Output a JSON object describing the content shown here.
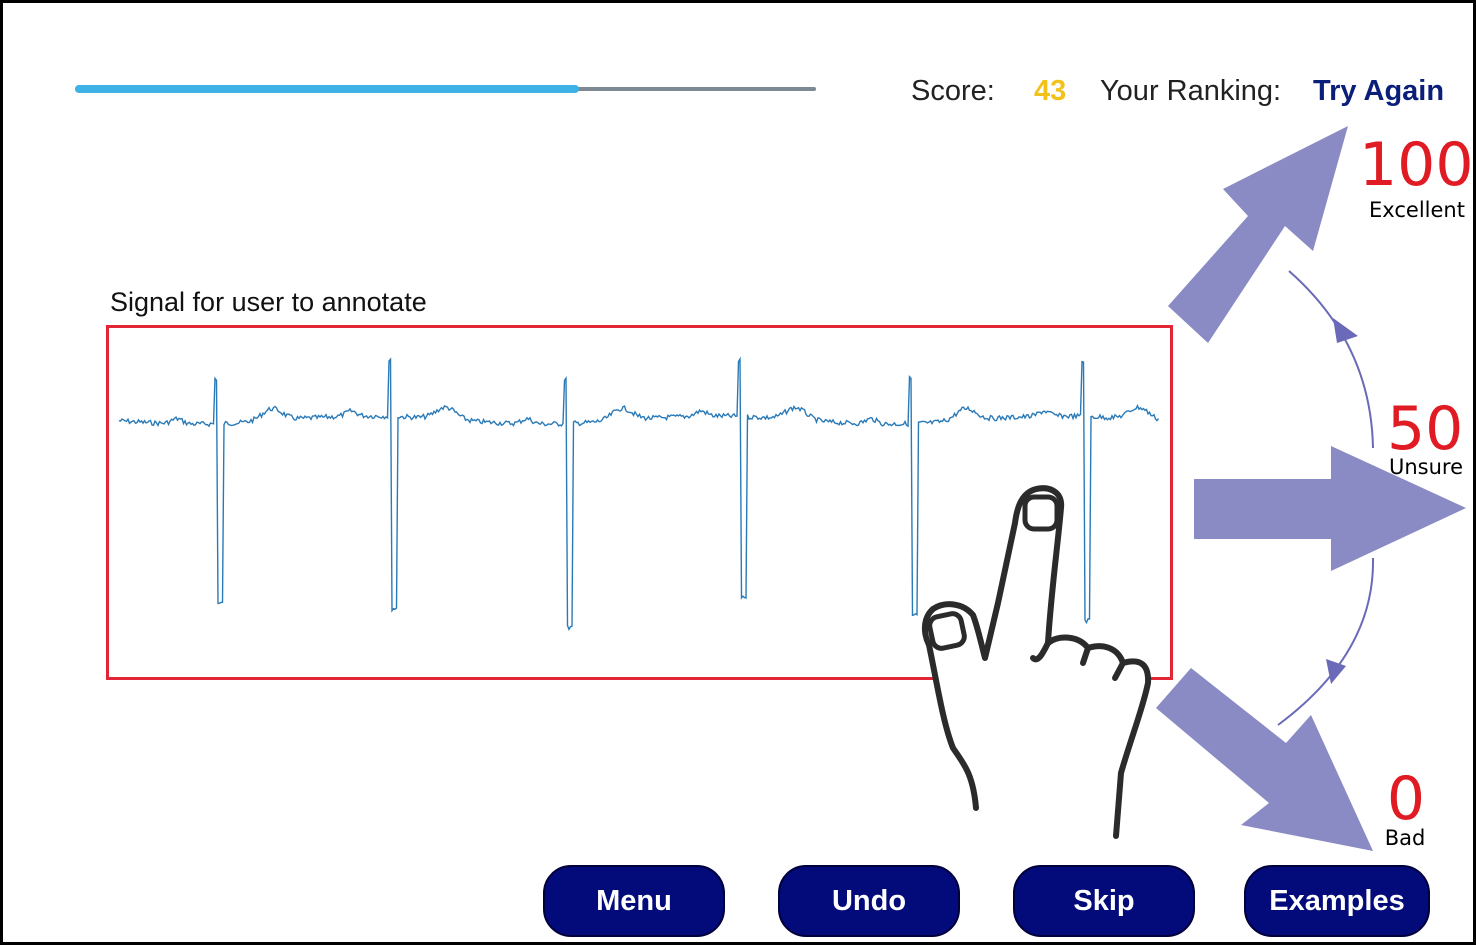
{
  "progress": {
    "fraction": 0.68
  },
  "header": {
    "score_label": "Score:",
    "score_value": "43",
    "ranking_label": "Your Ranking:",
    "ranking_value": "Try Again"
  },
  "signal": {
    "caption": "Signal for user to annotate",
    "beat_count": 6
  },
  "ratings": [
    {
      "value": "100",
      "label": "Excellent"
    },
    {
      "value": "50",
      "label": "Unsure"
    },
    {
      "value": "0",
      "label": "Bad"
    }
  ],
  "buttons": {
    "menu": "Menu",
    "undo": "Undo",
    "skip": "Skip",
    "examples": "Examples"
  },
  "colors": {
    "accent_red": "#e01b24",
    "score_yellow": "#f2c21b",
    "ranking_navy": "#0b1f7a",
    "arrow_purple": "#8a8ac4",
    "button_navy": "#030a7a",
    "signal_blue": "#2a7ab8",
    "progress_blue": "#3db2e6"
  },
  "icons": [
    "hand-pointer-icon",
    "arrow-up-right-icon",
    "arrow-right-icon",
    "arrow-down-right-icon"
  ]
}
